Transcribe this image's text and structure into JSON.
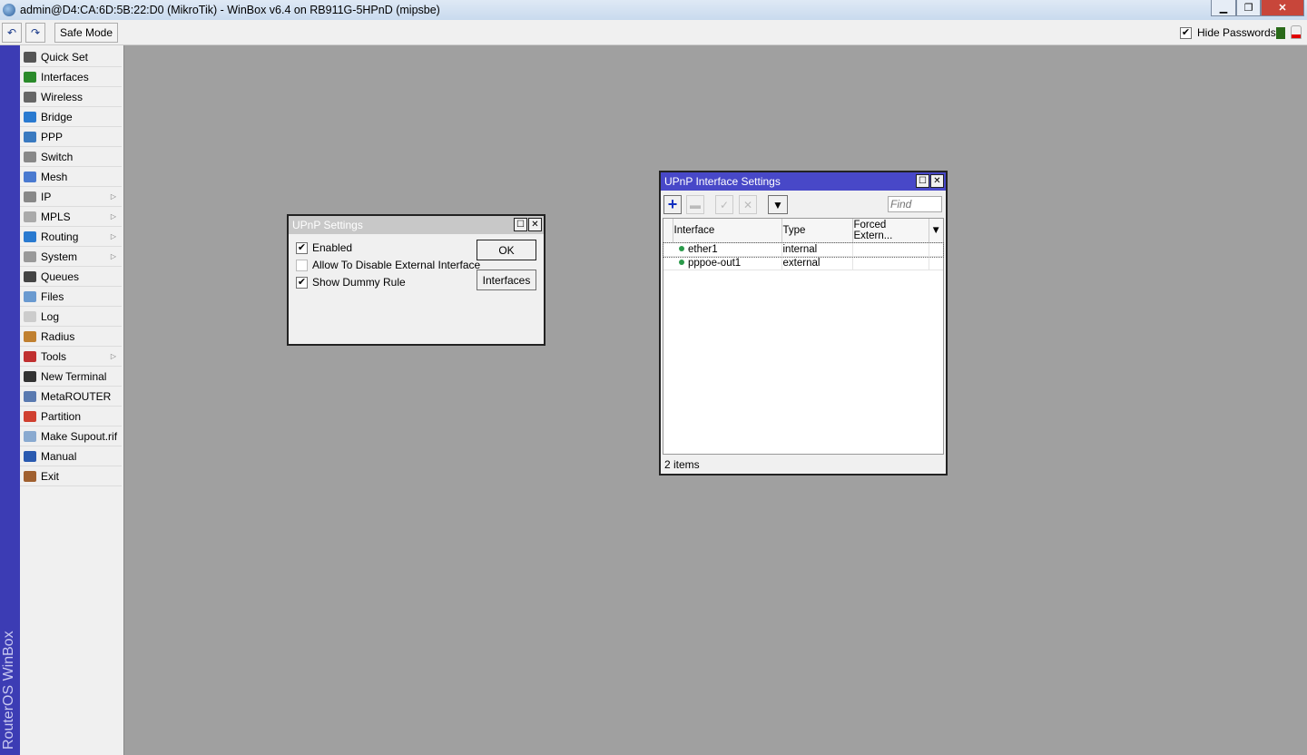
{
  "window": {
    "title": "admin@D4:CA:6D:5B:22:D0 (MikroTik) - WinBox v6.4 on RB911G-5HPnD (mipsbe)"
  },
  "toolbar": {
    "undo_icon": "undo-icon",
    "redo_icon": "redo-icon",
    "safe_mode": "Safe Mode",
    "hide_passwords": "Hide Passwords",
    "hide_passwords_checked": true
  },
  "sidebar": {
    "brand": "RouterOS WinBox",
    "items": [
      {
        "label": "Quick Set",
        "color": "#555"
      },
      {
        "label": "Interfaces",
        "color": "#2a8a2a"
      },
      {
        "label": "Wireless",
        "color": "#666"
      },
      {
        "label": "Bridge",
        "color": "#2a7ad0"
      },
      {
        "label": "PPP",
        "color": "#3a7ac0"
      },
      {
        "label": "Switch",
        "color": "#888"
      },
      {
        "label": "Mesh",
        "color": "#4a7ad0"
      },
      {
        "label": "IP",
        "color": "#888",
        "submenu": true
      },
      {
        "label": "MPLS",
        "color": "#aaa",
        "submenu": true
      },
      {
        "label": "Routing",
        "color": "#2a7ad0",
        "submenu": true
      },
      {
        "label": "System",
        "color": "#999",
        "submenu": true
      },
      {
        "label": "Queues",
        "color": "#444"
      },
      {
        "label": "Files",
        "color": "#6a9ad0"
      },
      {
        "label": "Log",
        "color": "#ccc"
      },
      {
        "label": "Radius",
        "color": "#c08030"
      },
      {
        "label": "Tools",
        "color": "#c03030",
        "submenu": true
      },
      {
        "label": "New Terminal",
        "color": "#333"
      },
      {
        "label": "MetaROUTER",
        "color": "#5a7ab0"
      },
      {
        "label": "Partition",
        "color": "#d04030"
      },
      {
        "label": "Make Supout.rif",
        "color": "#8aaad0"
      },
      {
        "label": "Manual",
        "color": "#2a5ab0"
      },
      {
        "label": "Exit",
        "color": "#a06030"
      }
    ]
  },
  "upnp_settings": {
    "title": "UPnP Settings",
    "enabled": "Enabled",
    "enabled_checked": true,
    "allow_disable": "Allow To Disable External Interface",
    "allow_disable_checked": false,
    "dummy_rule": "Show Dummy Rule",
    "dummy_rule_checked": true,
    "ok": "OK",
    "interfaces": "Interfaces"
  },
  "upnp_interfaces": {
    "title": "UPnP Interface Settings",
    "find_placeholder": "Find",
    "columns": [
      "Interface",
      "Type",
      "Forced Extern..."
    ],
    "rows": [
      {
        "interface": "ether1",
        "type": "internal",
        "forced": ""
      },
      {
        "interface": "pppoe-out1",
        "type": "external",
        "forced": ""
      }
    ],
    "status": "2 items",
    "accent": "#4848c8"
  }
}
